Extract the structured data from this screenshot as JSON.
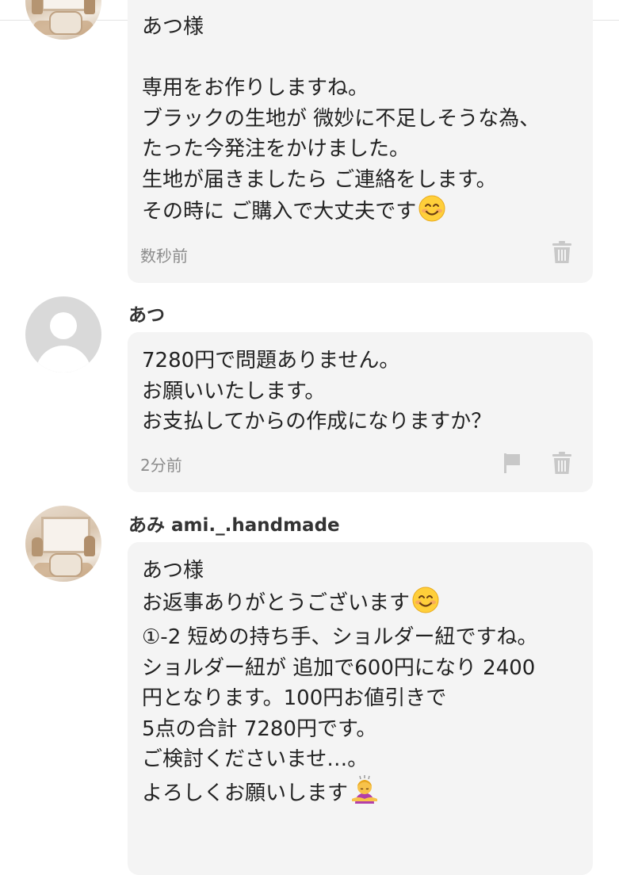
{
  "messages": [
    {
      "text": "あつ様\n\n専用をお作りしますね。\nブラックの生地が 微妙に不足しそうな為、\nたった今発注をかけました。\n生地が届きましたら ご連絡をします。\nその時に ご購入で大丈夫です",
      "emoji": "smiling-face-emoji",
      "time": "数秒前",
      "icons": [
        "trash-icon"
      ]
    },
    {
      "user": "あつ",
      "text": "7280円で問題ありません。\nお願いいたします。\nお支払してからの作成になりますか？",
      "time": "2分前",
      "icons": [
        "flag-icon",
        "trash-icon"
      ]
    },
    {
      "user": "あみ  ami._.handmade",
      "line1": "あつ様",
      "line2": "お返事ありがとうございます",
      "line2_emoji": "smiling-face-emoji",
      "body": "\n①-2  短めの持ち手、ショルダー紐ですね。\nショルダー紐が 追加で600円になり 2400\n円となります。100円お値引きで\n5点の合計  7280円です。\nご検討くださいませ…。",
      "last_line": "よろしくお願いします",
      "last_emoji": "person-bowing-emoji"
    }
  ],
  "colors": {
    "bubble": "#f4f4f4",
    "text": "#222222",
    "timestamp": "#8c8c8c",
    "icon": "#c8c8c8",
    "avatar_default": "#d9d9d9"
  }
}
